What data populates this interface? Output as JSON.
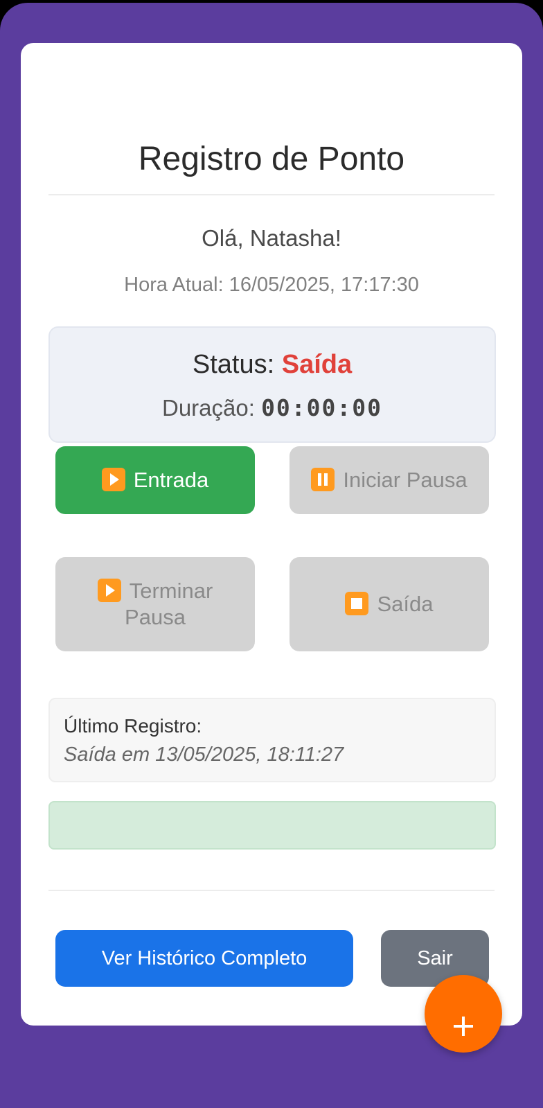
{
  "header": {
    "title": "Registro de Ponto"
  },
  "user": {
    "greeting": "Olá, Natasha!"
  },
  "clock": {
    "text": "Hora Atual: 16/05/2025, 17:17:30"
  },
  "status": {
    "label": "Status: ",
    "value": "Saída",
    "value_color": "#e0413a",
    "duration_label": "Duração: ",
    "duration_value": "00:00:00"
  },
  "actions": {
    "entrada": {
      "label": "Entrada",
      "icon": "play-icon",
      "enabled": true
    },
    "iniciar_pausa": {
      "label": "Iniciar Pausa",
      "icon": "pause-icon",
      "enabled": false
    },
    "terminar_pausa": {
      "label": "Terminar Pausa",
      "icon": "play-icon",
      "enabled": false
    },
    "saida": {
      "label": "Saída",
      "icon": "stop-icon",
      "enabled": false
    }
  },
  "last_record": {
    "label": "Último Registro:",
    "value": "Saída em 13/05/2025, 18:11:27"
  },
  "footer": {
    "history_label": "Ver Histórico Completo",
    "logout_label": "Sair"
  },
  "fab": {
    "icon": "plus-icon"
  },
  "colors": {
    "background": "#5b3d9e",
    "entrada_button": "#34a853",
    "history_button": "#1a73e8",
    "logout_button": "#6c737e",
    "fab": "#ff6d00"
  }
}
